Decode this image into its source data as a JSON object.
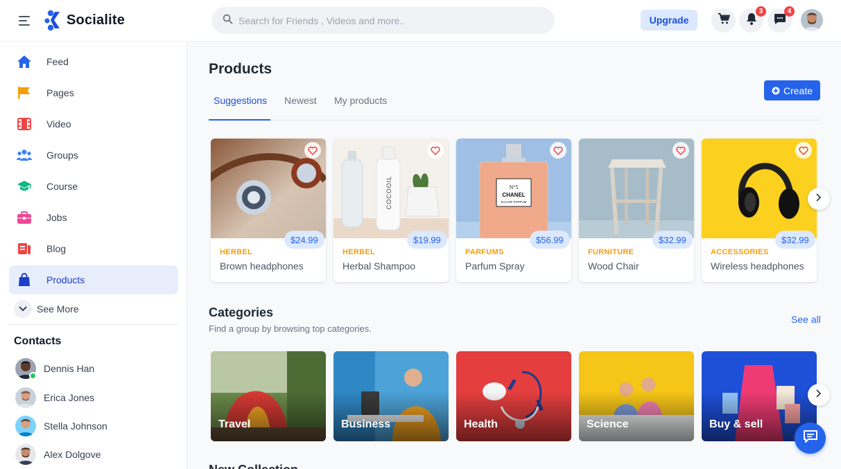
{
  "app": {
    "name": "Socialite"
  },
  "header": {
    "search_placeholder": "Search for Friends , Videos and more..",
    "upgrade_label": "Upgrade",
    "notifications_count": "3",
    "messages_count": "4",
    "icons": [
      "menu-icon",
      "search-icon",
      "cart-icon",
      "bell-icon",
      "chat-icon"
    ]
  },
  "sidebar": {
    "items": [
      {
        "label": "Feed",
        "icon": "home-icon"
      },
      {
        "label": "Pages",
        "icon": "flag-icon"
      },
      {
        "label": "Video",
        "icon": "film-icon"
      },
      {
        "label": "Groups",
        "icon": "users-icon"
      },
      {
        "label": "Course",
        "icon": "graduation-cap-icon"
      },
      {
        "label": "Jobs",
        "icon": "briefcase-icon"
      },
      {
        "label": "Blog",
        "icon": "blog-icon"
      },
      {
        "label": "Products",
        "icon": "shopping-bag-icon"
      }
    ],
    "active_item": "Products",
    "see_more": "See More",
    "contacts_title": "Contacts",
    "contacts": [
      {
        "name": "Dennis Han",
        "online": true
      },
      {
        "name": "Erica Jones"
      },
      {
        "name": "Stella Johnson"
      },
      {
        "name": "Alex Dolgove"
      }
    ]
  },
  "main": {
    "title": "Products",
    "tabs": [
      "Suggestions",
      "Newest",
      "My products"
    ],
    "active_tab": "Suggestions",
    "create_label": "Create",
    "products": [
      {
        "category": "HERBEL",
        "name": "Brown headphones",
        "price": "$24.99"
      },
      {
        "category": "HERBEL",
        "name": "Herbal Shampoo",
        "price": "$19.99"
      },
      {
        "category": "PARFUMS",
        "name": "Parfum Spray",
        "price": "$56.99",
        "bottle_text": [
          "N°5",
          "CHANEL",
          "EAU DE PARFUM"
        ],
        "shampoo_text": "COCOOIL"
      },
      {
        "category": "FURNITURE",
        "name": "Wood Chair",
        "price": "$32.99"
      },
      {
        "category": "ACCESSORIES",
        "name": "Wireless headphones",
        "price": "$32.99"
      }
    ],
    "categories_section": {
      "title": "Categories",
      "subtitle": "Find a group by browsing top categories.",
      "see_all": "See all",
      "items": [
        "Travel",
        "Business",
        "Health",
        "Science",
        "Buy & sell"
      ]
    },
    "next_section_title": "New Collection"
  },
  "colors": {
    "accent": "#2563eb",
    "category_label": "#f59e0b",
    "badge": "#ef4444"
  }
}
